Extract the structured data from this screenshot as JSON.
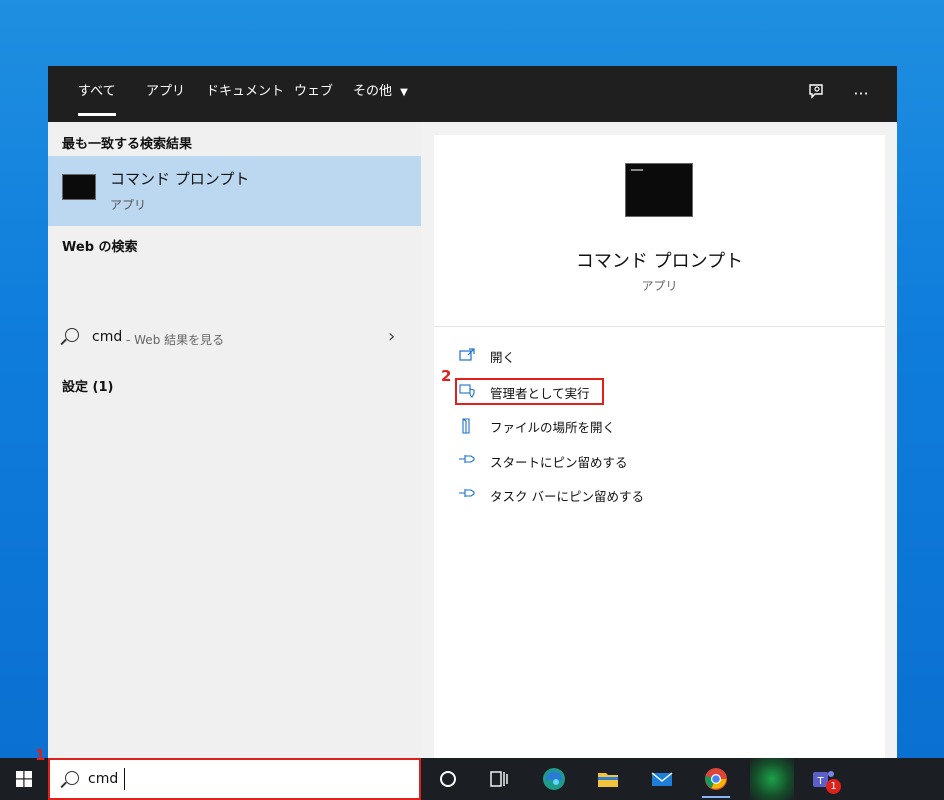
{
  "tabs": {
    "items": [
      "すべて",
      "アプリ",
      "ドキュメント",
      "ウェブ"
    ],
    "more_label": "その他",
    "active_index": 0
  },
  "left": {
    "best_match_header": "最も一致する検索結果",
    "best_match": {
      "title": "コマンド プロンプト",
      "subtitle": "アプリ"
    },
    "web_header": "Web の検索",
    "web_result": {
      "query": "cmd",
      "suffix": "- Web 結果を見る"
    },
    "settings_header": "設定 (1)"
  },
  "detail": {
    "title": "コマンド プロンプト",
    "subtitle": "アプリ",
    "actions": [
      "開く",
      "管理者として実行",
      "ファイルの場所を開く",
      "スタートにピン留めする",
      "タスク バーにピン留めする"
    ],
    "highlighted_action_index": 1
  },
  "markers": {
    "search": "1",
    "admin": "2"
  },
  "search": {
    "value": "cmd"
  },
  "taskbar": {
    "icons": [
      "cortana-icon",
      "task-view-icon",
      "edge-icon",
      "file-explorer-icon",
      "mail-icon",
      "chrome-icon",
      "app-icon",
      "teams-icon"
    ],
    "teams_badge": "1"
  },
  "colors": {
    "selection": "#bcd8f1",
    "highlight_box": "#e0201b",
    "accent": "#1a6fcf",
    "tab_bar": "#1f1f1f"
  }
}
